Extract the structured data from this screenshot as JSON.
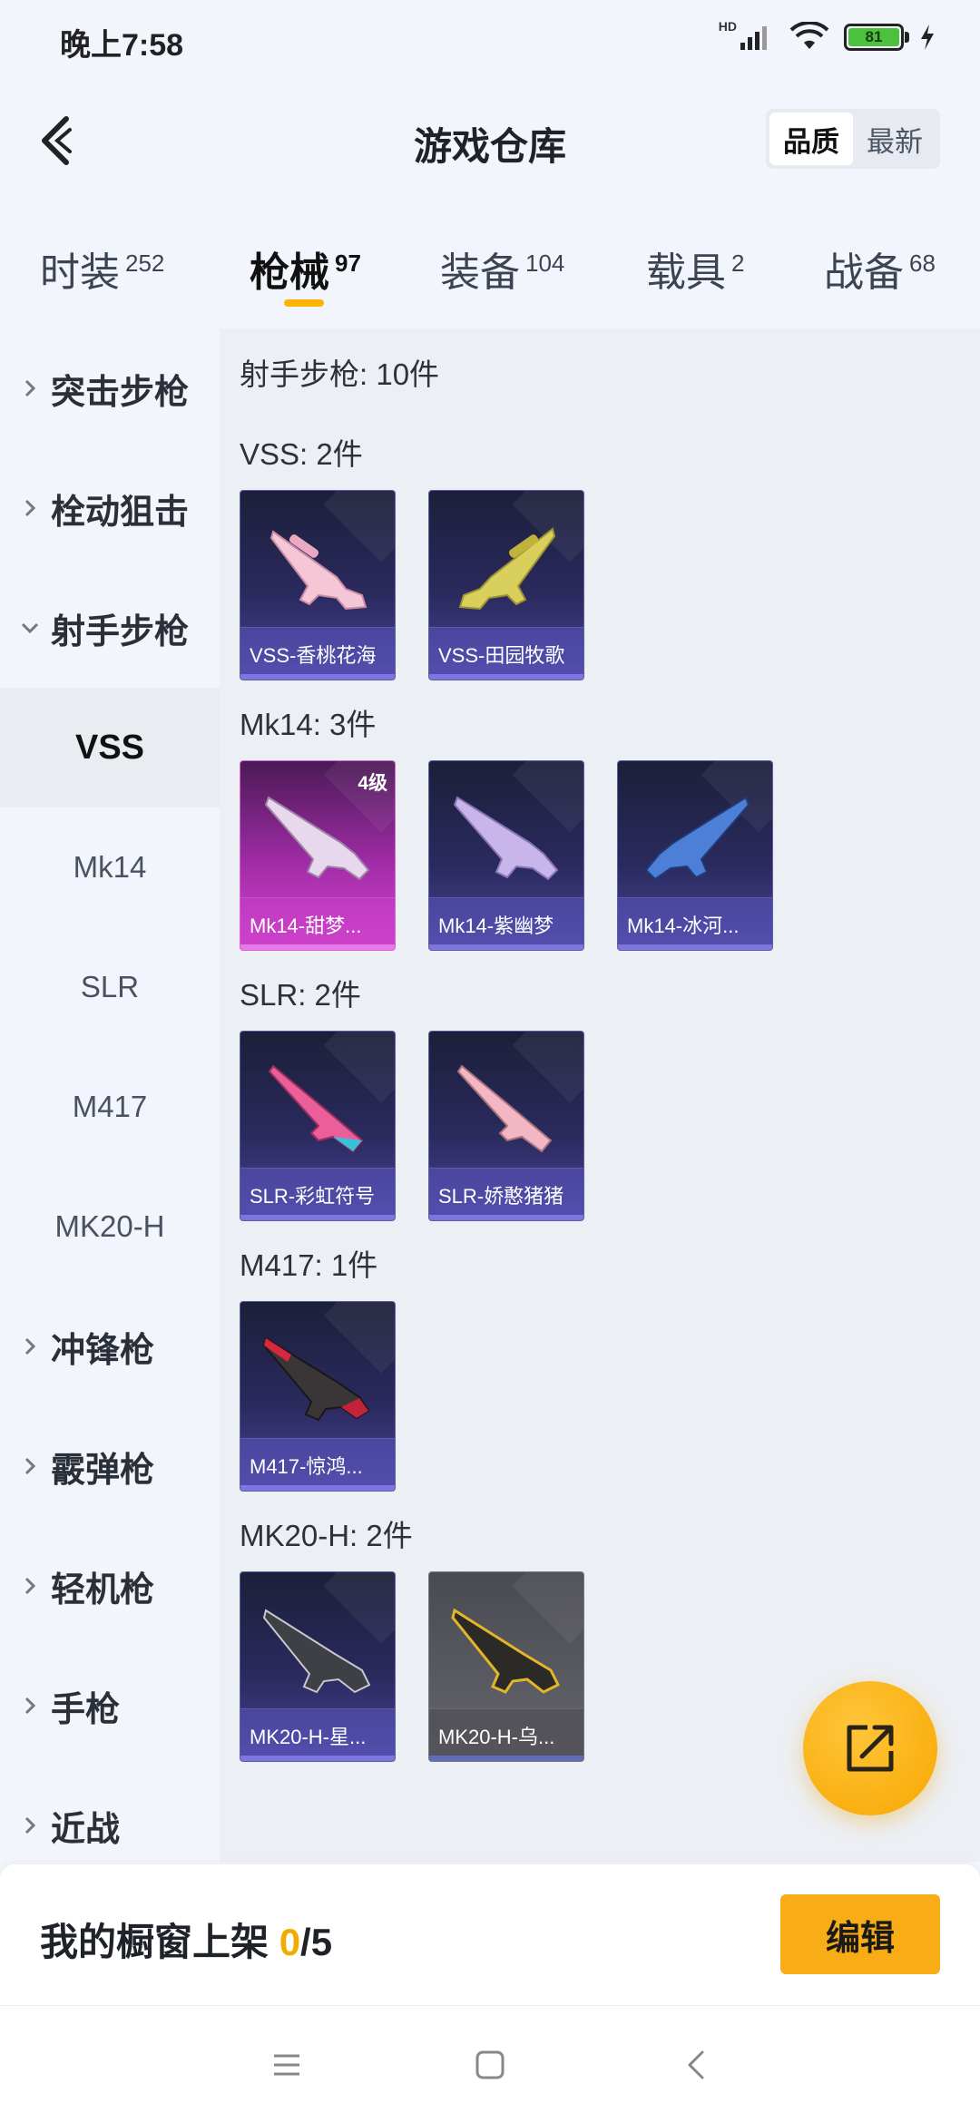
{
  "status_bar": {
    "time": "晚上7:58",
    "hd_label": "HD",
    "battery": "81"
  },
  "header": {
    "title": "游戏仓库",
    "sort_options": [
      "品质",
      "最新"
    ],
    "active_sort": "品质"
  },
  "tabs": [
    {
      "label": "时装",
      "count": "252"
    },
    {
      "label": "枪械",
      "count": "97",
      "active": true
    },
    {
      "label": "装备",
      "count": "104"
    },
    {
      "label": "载具",
      "count": "2"
    },
    {
      "label": "战备",
      "count": "68"
    }
  ],
  "sidebar": {
    "categories": [
      "突击步枪",
      "栓动狙击",
      "射手步枪",
      "冲锋枪",
      "霰弹枪",
      "轻机枪",
      "手枪",
      "近战"
    ],
    "expanded": "射手步枪",
    "sub_items": [
      "VSS",
      "Mk14",
      "SLR",
      "M417",
      "MK20-H"
    ],
    "selected_sub": "VSS"
  },
  "content": {
    "section_title": "射手步枪: 10件",
    "groups": [
      {
        "title": "VSS: 2件",
        "items": [
          {
            "name": "VSS-香桃花海",
            "style": "purple"
          },
          {
            "name": "VSS-田园牧歌",
            "style": "purple"
          }
        ]
      },
      {
        "title": "Mk14: 3件",
        "items": [
          {
            "name": "Mk14-甜梦...",
            "style": "pink",
            "level": "4级"
          },
          {
            "name": "Mk14-紫幽梦",
            "style": "purple"
          },
          {
            "name": "Mk14-冰河...",
            "style": "purple"
          }
        ]
      },
      {
        "title": "SLR: 2件",
        "items": [
          {
            "name": "SLR-彩虹符号",
            "style": "purple"
          },
          {
            "name": "SLR-娇憨猪猪",
            "style": "purple"
          }
        ]
      },
      {
        "title": "M417: 1件",
        "items": [
          {
            "name": "M417-惊鸿...",
            "style": "purple"
          }
        ]
      },
      {
        "title": "MK20-H: 2件",
        "items": [
          {
            "name": "MK20-H-星...",
            "style": "purple"
          },
          {
            "name": "MK20-H-乌...",
            "style": "gray"
          }
        ]
      }
    ]
  },
  "bottom": {
    "showcase_label": "我的橱窗上架",
    "showcase_count": "0",
    "showcase_total": "/5",
    "edit_label": "编辑"
  },
  "colors": {
    "accent": "#f8ad16",
    "card_purple": "#2a2a5e",
    "card_pink": "#a22ca8"
  },
  "icons": {
    "back": "chevron-left-icon",
    "fab": "share-external-icon",
    "nav": [
      "menu-icon",
      "home-square-icon",
      "back-triangle-icon"
    ]
  }
}
